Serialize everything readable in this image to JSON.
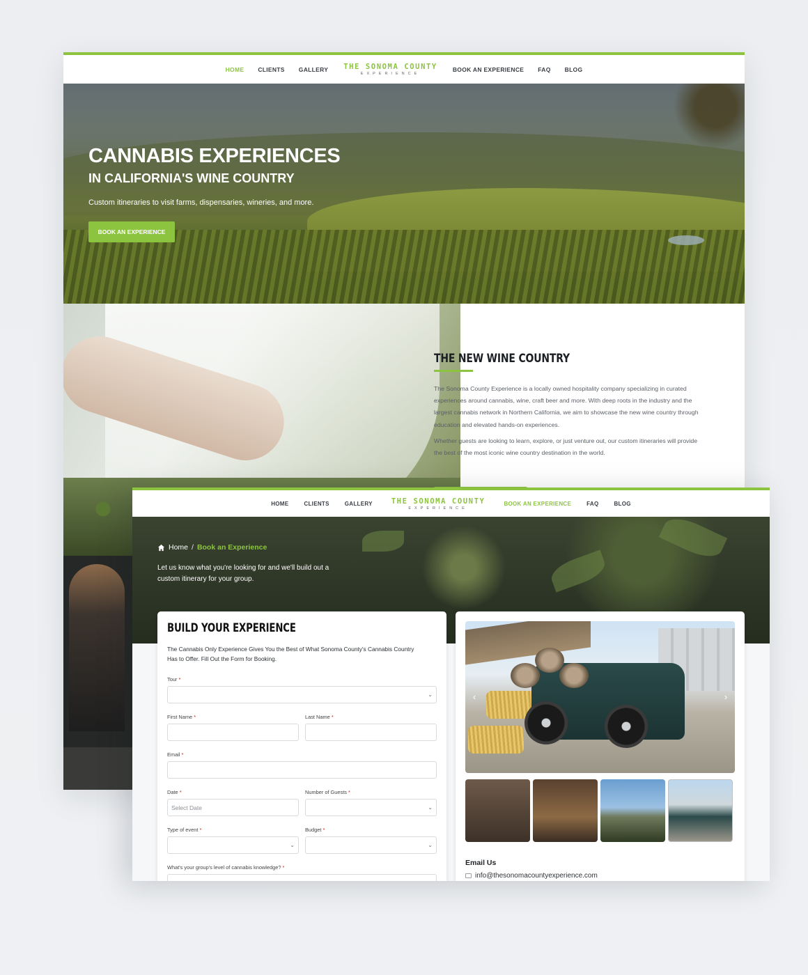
{
  "nav": {
    "items": [
      "HOME",
      "CLIENTS",
      "GALLERY",
      "BOOK AN EXPERIENCE",
      "FAQ",
      "BLOG"
    ],
    "logo_line1": "THE SONOMA COUNTY",
    "logo_line2": "EXPERIENCE",
    "accent_color": "#8cc43f"
  },
  "back_page": {
    "hero": {
      "title": "CANNABIS EXPERIENCES",
      "subtitle": "IN CALIFORNIA'S WINE COUNTRY",
      "tagline": "Custom itineraries to visit farms, dispensaries, wineries, and more.",
      "cta": "BOOK AN EXPERIENCE"
    },
    "about": {
      "heading": "THE NEW WINE COUNTRY",
      "p1": "The Sonoma County Experience is a locally owned hospitality company specializing in curated experiences around cannabis, wine, craft beer and more. With deep roots in the industry and the largest cannabis network in Northern California, we aim to showcase the new wine country through education and elevated hands-on experiences.",
      "p2": "Whether guests are looking to learn, explore, or just venture out, our custom itineraries will provide the best of the most iconic wine country destination in the world."
    }
  },
  "front_page": {
    "breadcrumb": {
      "home": "Home",
      "separator": "/",
      "current": "Book an Experience"
    },
    "intro": "Let us know what you're looking for and we'll build out a custom itinerary for your group.",
    "form": {
      "title": "BUILD YOUR EXPERIENCE",
      "subtitle": "The Cannabis Only Experience Gives You the Best of What Sonoma County's Cannabis Country Has to Offer. Fill Out the Form for Booking.",
      "required_mark": "*",
      "fields": {
        "tour": {
          "label": "Tour",
          "value": ""
        },
        "first_name": {
          "label": "First Name",
          "value": ""
        },
        "last_name": {
          "label": "Last Name",
          "value": ""
        },
        "email": {
          "label": "Email",
          "value": ""
        },
        "date": {
          "label": "Date",
          "placeholder": "Select Date"
        },
        "guests": {
          "label": "Number of Guests",
          "value": ""
        },
        "event_type": {
          "label": "Type of event",
          "value": ""
        },
        "budget": {
          "label": "Budget",
          "value": ""
        },
        "knowledge": {
          "label": "What's your group's level of cannabis knowledge?",
          "value": ""
        }
      }
    },
    "gallery": {
      "thumb_count": 4,
      "email_title": "Email Us",
      "email": "info@thesonomacountyexperience.com"
    }
  }
}
